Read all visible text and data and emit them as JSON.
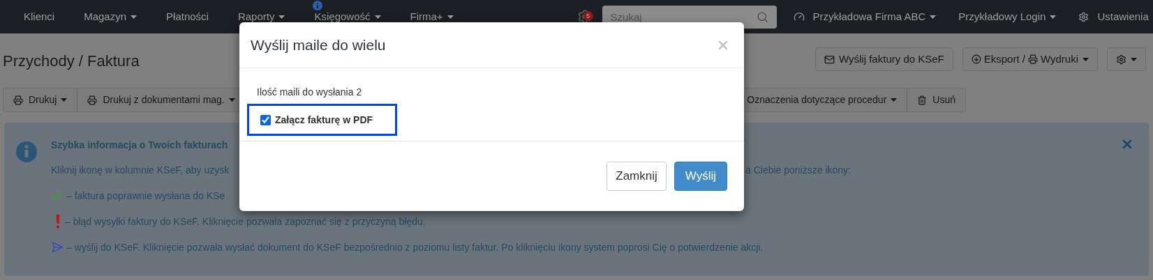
{
  "navbar": {
    "items": [
      {
        "label": "Klienci",
        "dropdown": false,
        "info_badge": false
      },
      {
        "label": "Magazyn",
        "dropdown": true,
        "info_badge": false
      },
      {
        "label": "Płatności",
        "dropdown": false,
        "info_badge": false
      },
      {
        "label": "Raporty",
        "dropdown": true,
        "info_badge": false
      },
      {
        "label": "Księgowość",
        "dropdown": true,
        "info_badge": true
      },
      {
        "label": "Firma+",
        "dropdown": true,
        "info_badge": false
      }
    ],
    "notifications_count": "5",
    "search": {
      "placeholder": "Szukaj"
    },
    "right_items": [
      {
        "kind": "dashboard",
        "label": "Przykładowa Firma ABC"
      },
      {
        "kind": "plain",
        "label": "Przykładowy Login"
      },
      {
        "kind": "gear",
        "label": "Ustawienia"
      }
    ]
  },
  "page_title": "Przychody / Faktura",
  "header_buttons": [
    {
      "kind": "ksef",
      "label": "Wyślij faktury do KSeF"
    },
    {
      "kind": "export",
      "label": "Eksport /",
      "label_2": "Wydruki"
    },
    {
      "kind": "gear"
    }
  ],
  "toolbar": {
    "left": [
      {
        "label": "Drukuj",
        "kind": "print",
        "dropdown": true
      },
      {
        "label": "Drukuj z dokumentami mag.",
        "kind": "print",
        "dropdown": true
      }
    ],
    "right": [
      {
        "label": "Oznaczenia dotyczące procedur",
        "kind": "menu",
        "dropdown": true
      },
      {
        "label": "Usuń",
        "kind": "delete",
        "dropdown": false
      }
    ]
  },
  "info": {
    "title": "Szybka informacja o Twoich fakturach",
    "intro_left": "Kliknij ikonę w kolumnie KSeF, aby uzysk",
    "intro_right": "a Ciebie poniższe ikony:",
    "items": [
      {
        "kind": "sent",
        "text": "– faktura poprawnie wysłana do KSe"
      },
      {
        "kind": "error",
        "text": "– błąd wysyłki faktury do KSeF. Kliknięcie pozwala zapoznać się z przyczyną błędu."
      },
      {
        "kind": "send",
        "text": "– wyślij do KSeF. Kliknięcie pozwala wysłać dokument do KSeF bezpośrednio z poziomu listy faktur. Po kliknięciu ikony system poprosi Cię o potwierdzenie akcji."
      }
    ]
  },
  "modal": {
    "title": "Wyślij maile do wielu",
    "count_text": "Ilość maili do wysłania 2",
    "checkbox": {
      "label": "Załącz fakturę w PDF",
      "checked": true
    },
    "buttons": [
      {
        "label": "Zamknij",
        "kind": "default"
      },
      {
        "label": "Wyślij",
        "kind": "primary"
      }
    ]
  }
}
